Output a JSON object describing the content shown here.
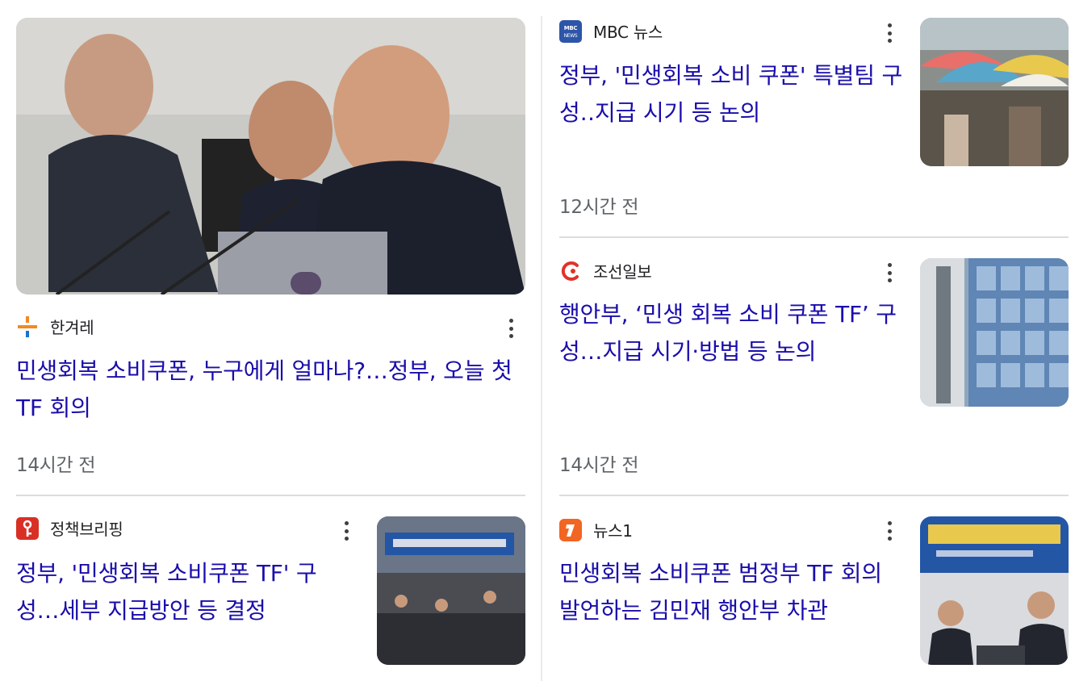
{
  "articles": [
    {
      "source": "한겨레",
      "logo_icon": "hankyoreh-logo-icon",
      "headline": "민생회복 소비쿠폰, 누구에게 얼마나?…정부, 오늘 첫 TF 회의",
      "time": "14시간 전",
      "image_icon": "officials-meeting-photo"
    },
    {
      "source": "MBC 뉴스",
      "logo_icon": "mbc-news-logo-icon",
      "headline": "정부, '민생회복 소비 쿠폰' 특별팀 구성‥지급 시기 등 논의",
      "time": "12시간 전",
      "image_icon": "market-umbrellas-photo"
    },
    {
      "source": "조선일보",
      "logo_icon": "chosun-logo-icon",
      "headline": "행안부, ‘민생 회복 소비 쿠폰 TF’ 구성…지급 시기·방법 등 논의",
      "time": "14시간 전",
      "image_icon": "government-building-photo"
    },
    {
      "source": "정책브리핑",
      "logo_icon": "korea-policy-logo-icon",
      "headline": "정부, '민생회복 소비쿠폰 TF' 구성…세부 지급방안 등 결정",
      "image_icon": "tf-meeting-photo"
    },
    {
      "source": "뉴스1",
      "logo_icon": "news1-logo-icon",
      "headline": "민생회복 소비쿠폰 범정부 TF 회의 발언하는 김민재 행안부 차관",
      "image_icon": "vice-minister-speech-photo"
    }
  ],
  "colors": {
    "headline": "#1a0dab",
    "meta_text": "#5f6368",
    "divider": "#dadce0",
    "hankyoreh_orange": "#f08a24",
    "hankyoreh_blue": "#1a73c9",
    "mbc_blue": "#2d55a8",
    "chosun_red": "#e0322a",
    "policy_red": "#d93025",
    "news1_orange": "#f26522"
  }
}
